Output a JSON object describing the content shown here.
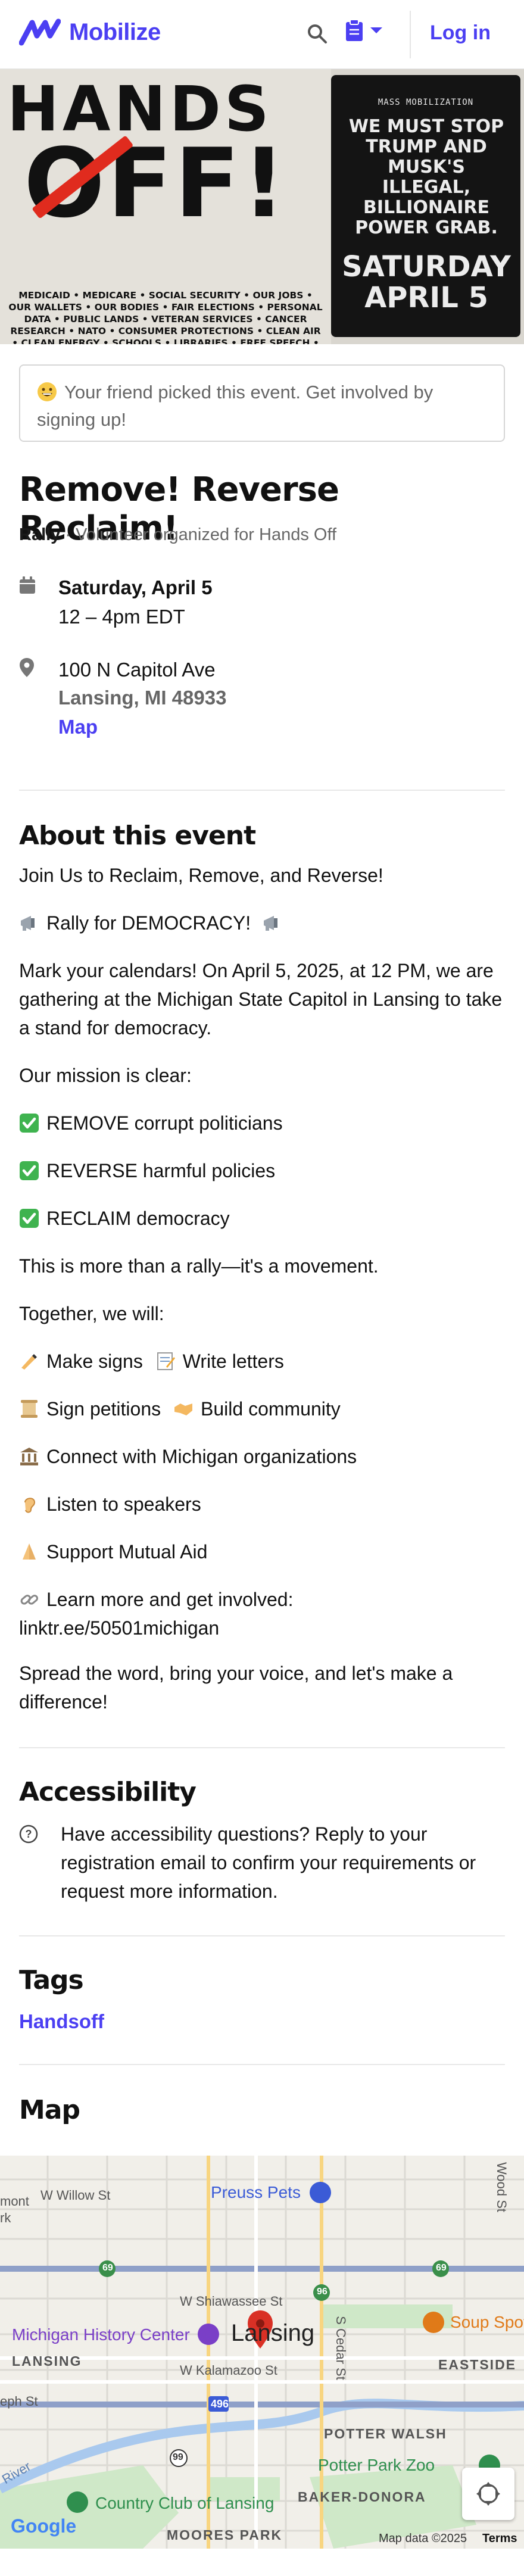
{
  "header": {
    "logo_text": "Mobilize",
    "login_label": "Log in",
    "brand_color": "#4b3ff2"
  },
  "banner": {
    "headline_top": "HANDS",
    "headline_bottom": "OFF!",
    "issues": "MEDICAID • MEDICARE • SOCIAL SECURITY • OUR JOBS • OUR WALLETS • OUR BODIES • FAIR ELECTIONS • PERSONAL DATA • PUBLIC LANDS • VETERAN SERVICES • CANCER RESEARCH • NATO • CONSUMER PROTECTIONS • CLEAN AIR • CLEAN ENERGY • SCHOOLS • LIBRARIES • FREE SPEECH • LGBTQ+ RIGHTS • IMMIGRANTS • COURTS • MORE",
    "right_kicker": "MASS MOBILIZATION",
    "right_message": "WE MUST STOP TRUMP AND MUSK'S ILLEGAL, BILLIONAIRE POWER GRAB.",
    "right_date": "SATURDAY APRIL 5",
    "strike_color": "#e02b1e"
  },
  "notice": {
    "emoji": "grinning-face-icon",
    "text": "Your friend picked this event. Get involved by signing up!"
  },
  "event": {
    "title": "Remove! Reverse Reclaim!",
    "type": "Rally",
    "organizer": " · Volunteer organized for Hands Off",
    "date": "Saturday, April 5",
    "time": "12 – 4pm EDT",
    "address_line1": "100 N Capitol Ave",
    "address_line2": "Lansing, MI 48933",
    "map_link": "Map"
  },
  "about": {
    "heading": "About this event",
    "p1": "Join Us to Reclaim, Remove, and Reverse!",
    "p2": "Rally for DEMOCRACY!",
    "p3": "Mark your calendars! On April 5, 2025, at 12 PM, we are gathering at the Michigan State Capitol in Lansing to take a stand for democracy.",
    "p4": "Our mission is clear:",
    "m1": "REMOVE corrupt politicians",
    "m2": "REVERSE harmful policies",
    "m3": "RECLAIM democracy",
    "p5": "This is more than a rally—it's a movement.",
    "p6": "Together, we will:",
    "w1a": "Make signs",
    "w1b": "Write letters",
    "w2a": "Sign petitions",
    "w2b": "Build community",
    "w3": "Connect with Michigan organizations",
    "w4": "Listen to speakers",
    "w5": "Support Mutual Aid",
    "link_intro": "Learn more and get involved:",
    "link": "linktr.ee/50501michigan",
    "closing": "Spread the word, bring your voice, and let's make a difference!"
  },
  "accessibility": {
    "heading": "Accessibility",
    "text": "Have accessibility questions? Reply to your registration email to confirm your requirements or request more information."
  },
  "tags": {
    "heading": "Tags",
    "items": [
      "Handsoff"
    ]
  },
  "map": {
    "heading": "Map",
    "labels": {
      "willow": "W Willow St",
      "preuss": "Preuss Pets",
      "wood": "Wood St",
      "mont": "mont",
      "rk": "rk",
      "shiawassee": "W Shiawassee St",
      "history": "Michigan History Center",
      "lansing": "Lansing",
      "soup": "Soup Spot",
      "kalamazoo": "W Kalamazoo St",
      "cedar": "S Cedar St",
      "eastside": "EASTSIDE",
      "lansing_caps": "LANSING",
      "eph": "eph St",
      "potter": "POTTER WALSH",
      "zoo": "Potter Park Zoo",
      "country": "Country Club of Lansing",
      "baker": "BAKER-DONORA",
      "moores": "MOORES PARK",
      "river": "River",
      "highway": "496",
      "route69": "69",
      "route96": "96",
      "route99": "99"
    },
    "google": "Google",
    "map_data": "Map data ©2025",
    "terms": "Terms"
  }
}
